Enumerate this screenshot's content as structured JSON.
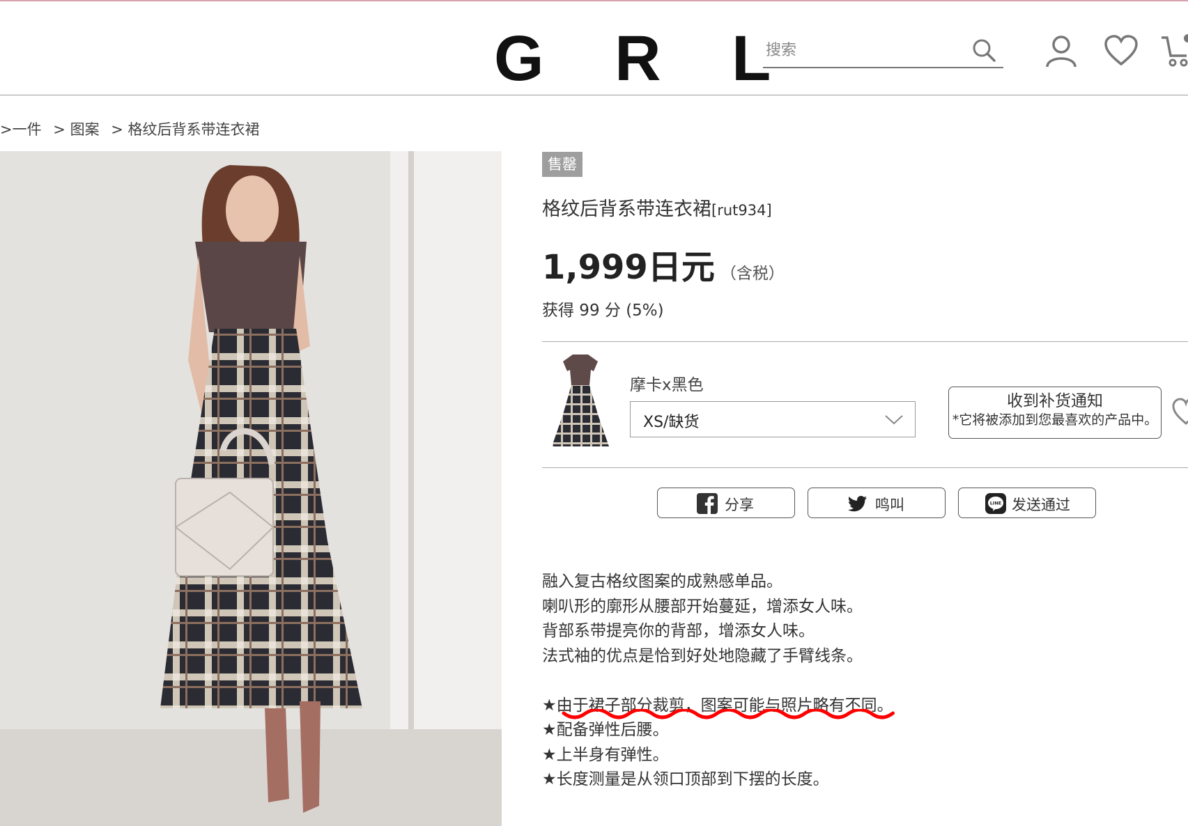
{
  "header": {
    "logo": "G R L",
    "search_placeholder": "搜索"
  },
  "breadcrumb": [
    ">一件",
    "> 图案",
    "> 格纹后背系带连衣裙"
  ],
  "product": {
    "badge": "售罄",
    "title": "格纹后背系带连衣裙",
    "code": "[rut934]",
    "price": "1,999日元",
    "tax_note": "（含税）",
    "points": "获得 99 分 (5%)",
    "color": "摩卡x黑色",
    "size_selected": "XS/缺货",
    "notify_title": "收到补货通知",
    "notify_note": "*它将被添加到您最喜欢的产品中。"
  },
  "share": {
    "facebook": "分享",
    "twitter": "鸣叫",
    "line": "发送通过"
  },
  "description": [
    "融入复古格纹图案的成熟感单品。",
    "喇叭形的廓形从腰部开始蔓延，增添女人味。",
    "背部系带提亮你的背部，增添女人味。",
    "法式袖的优点是恰到好处地隐藏了手臂线条。",
    "",
    "★由于裙子部分裁剪，图案可能与照片略有不同。",
    "★配备弹性后腰。",
    "★上半身有弹性。",
    "★长度测量是从领口顶部到下摆的长度。"
  ],
  "colors": {
    "accent_top": "#d9a0b0",
    "soldout_bg": "#9e9e9e",
    "squiggle": "#ff0000"
  }
}
